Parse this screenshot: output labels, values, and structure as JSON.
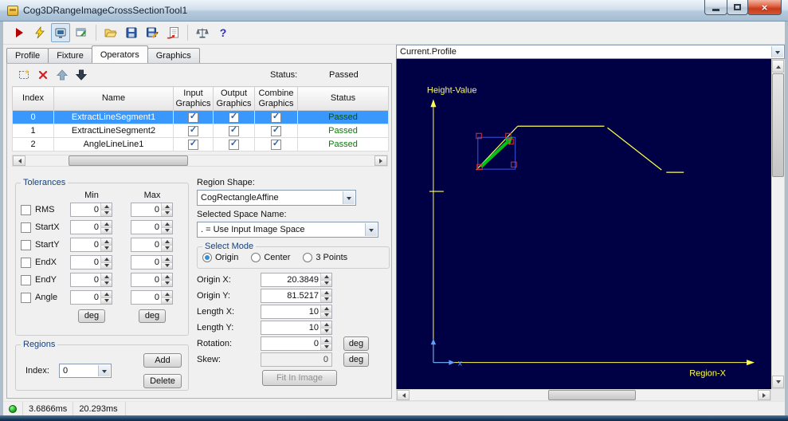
{
  "window": {
    "title": "Cog3DRangeImageCrossSectionTool1"
  },
  "icons": {
    "check": "✓",
    "close": "×",
    "help": "?"
  },
  "toolbar": {
    "icon_names": [
      "run",
      "trigger",
      "image-display",
      "float-display",
      "open-file",
      "save",
      "save-as",
      "import",
      "scales",
      "help"
    ]
  },
  "tabs": {
    "items": [
      {
        "label": "Profile"
      },
      {
        "label": "Fixture"
      },
      {
        "label": "Operators"
      },
      {
        "label": "Graphics"
      }
    ],
    "active": "Operators"
  },
  "operators": {
    "status_label": "Status:",
    "status_value": "Passed",
    "table": {
      "headers": [
        "Index",
        "Name",
        "Input Graphics",
        "Output Graphics",
        "Combine Graphics",
        "Status"
      ],
      "rows": [
        {
          "index": "0",
          "name": "ExtractLineSegment1",
          "input_graphics": true,
          "output_graphics": true,
          "combine_graphics": true,
          "status": "Passed",
          "selected": true
        },
        {
          "index": "1",
          "name": "ExtractLineSegment2",
          "input_graphics": true,
          "output_graphics": true,
          "combine_graphics": true,
          "status": "Passed",
          "selected": false
        },
        {
          "index": "2",
          "name": "AngleLineLine1",
          "input_graphics": true,
          "output_graphics": true,
          "combine_graphics": true,
          "status": "Passed",
          "selected": false
        }
      ]
    }
  },
  "tolerances": {
    "title": "Tolerances",
    "col_min": "Min",
    "col_max": "Max",
    "deg": "deg",
    "rows": [
      {
        "label": "RMS",
        "min": "0",
        "max": "0",
        "checked": false
      },
      {
        "label": "StartX",
        "min": "0",
        "max": "0",
        "checked": false
      },
      {
        "label": "StartY",
        "min": "0",
        "max": "0",
        "checked": false
      },
      {
        "label": "EndX",
        "min": "0",
        "max": "0",
        "checked": false
      },
      {
        "label": "EndY",
        "min": "0",
        "max": "0",
        "checked": false
      },
      {
        "label": "Angle",
        "min": "0",
        "max": "0",
        "checked": false
      }
    ]
  },
  "regions": {
    "title": "Regions",
    "index_label": "Index:",
    "index_value": "0",
    "add": "Add",
    "delete": "Delete"
  },
  "region_editor": {
    "shape_label": "Region Shape:",
    "shape_value": "CogRectangleAffine",
    "space_label": "Selected Space Name:",
    "space_value": ". = Use Input Image Space",
    "mode_title": "Select Mode",
    "modes": [
      {
        "label": "Origin",
        "selected": true
      },
      {
        "label": "Center",
        "selected": false
      },
      {
        "label": "3 Points",
        "selected": false
      }
    ],
    "fields": [
      {
        "label": "Origin X:",
        "value": "20.3849"
      },
      {
        "label": "Origin Y:",
        "value": "81.5217"
      },
      {
        "label": "Length X:",
        "value": "10"
      },
      {
        "label": "Length Y:",
        "value": "10"
      },
      {
        "label": "Rotation:",
        "value": "0",
        "unit": "deg"
      },
      {
        "label": "Skew:",
        "value": "0",
        "unit": "deg",
        "disabled": true
      }
    ],
    "fit_button": "Fit In Image"
  },
  "profile_view": {
    "selector": "Current.Profile",
    "y_axis_label": "Height-Value",
    "x_axis_label": "Region-X",
    "origin_marker": "x",
    "colors": {
      "background": "#000045",
      "profile": "#ffff4d",
      "region_arrow": "#00c414",
      "handles": "#e03030",
      "region_rect": "#3a55e0",
      "origin_axes": "#5f9fff"
    },
    "profile_segments": [
      [
        [
          41,
          166
        ],
        [
          59,
          166
        ]
      ],
      [
        [
          100,
          139
        ],
        [
          152,
          84
        ]
      ],
      [
        [
          152,
          84
        ],
        [
          261,
          84
        ]
      ],
      [
        [
          265,
          86
        ],
        [
          333,
          139
        ]
      ],
      [
        [
          339,
          142
        ],
        [
          361,
          142
        ]
      ]
    ]
  },
  "statusbar": {
    "time1": "3.6866ms",
    "time2": "20.293ms"
  }
}
